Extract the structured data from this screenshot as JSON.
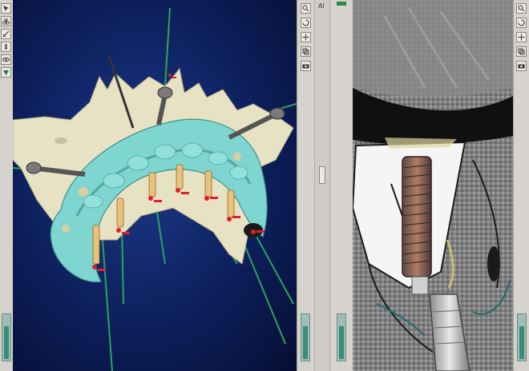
{
  "left_panel": {
    "corner_label": "Al"
  },
  "colors": {
    "background_3d": "#0d1f5c",
    "bone": "#e8e2c4",
    "surgical_guide": "#7fd6d0",
    "drill_axis": "#2aa55a",
    "measure_marker": "#e0202a",
    "panel_gray": "#d6d3ce",
    "slider_fill": "#3a8c7a"
  },
  "sliders": {
    "left_view_level": 0.7,
    "right_toolbar_level": 0.7,
    "ct_left_level": 0.7,
    "ct_right_level": 0.7
  },
  "toolbar_3d": {
    "buttons": [
      "zoom-icon",
      "rotate-icon",
      "pan-icon",
      "layers-icon",
      "camera-icon"
    ]
  },
  "toolbar_left": {
    "buttons": [
      "select-icon",
      "cut-icon",
      "measure-icon",
      "implant-icon",
      "eye-icon",
      "sweep-icon"
    ]
  }
}
